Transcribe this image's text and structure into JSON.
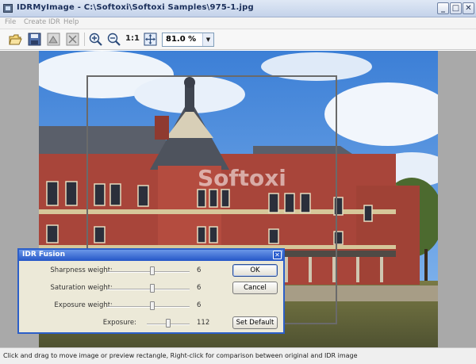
{
  "window": {
    "title": "IDRMyImage - C:\\Softoxi\\Softoxi Samples\\975-1.jpg",
    "controls": {
      "minimize": "_",
      "maximize": "□",
      "close": "✕"
    }
  },
  "menu": {
    "items": [
      "File",
      "Create IDR",
      "Help"
    ]
  },
  "toolbar": {
    "buttons": [
      "open-icon",
      "save-icon",
      "adjust-icon",
      "compare-icon",
      "zoom-in-icon",
      "zoom-out-icon",
      "actual-size",
      "fit-icon"
    ],
    "actual_size_label": "1:1",
    "zoom_value": "81.0 %"
  },
  "watermark": {
    "text": "Softoxi"
  },
  "fusion_dialog": {
    "title": "IDR Fusion",
    "close_label": "✕",
    "sliders": [
      {
        "label": "Sharpness weight:",
        "value": "6",
        "fraction": 0.55
      },
      {
        "label": "Saturation weight:",
        "value": "6",
        "fraction": 0.55
      },
      {
        "label": "Exposure weight:",
        "value": "6",
        "fraction": 0.55
      },
      {
        "label": "Exposure:",
        "value": "112",
        "fraction": 0.5
      }
    ],
    "buttons": {
      "ok": "OK",
      "cancel": "Cancel",
      "set_default": "Set Default"
    }
  },
  "statusbar": {
    "text": "Click and drag to move image or preview rectangle, Right-click for comparison between original and IDR image"
  },
  "colors": {
    "titlebar": "#c4d3ea",
    "dialog_title": "#2556c7",
    "sky": "#4d8ee0",
    "brick": "#a8453a"
  }
}
